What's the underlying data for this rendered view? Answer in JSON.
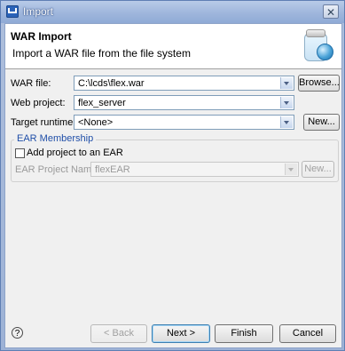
{
  "window": {
    "title": "Import"
  },
  "header": {
    "title": "WAR Import",
    "description": "Import a WAR file from the file system"
  },
  "form": {
    "war_file": {
      "label": "WAR file:",
      "value": "C:\\lcds\\flex.war",
      "browse_label": "Browse..."
    },
    "web_project": {
      "label": "Web project:",
      "value": "flex_server"
    },
    "target_runtime": {
      "label": "Target runtime:",
      "value": "<None>",
      "new_label": "New..."
    }
  },
  "ear_membership": {
    "title": "EAR Membership",
    "add_to_ear_label": "Add project to an EAR",
    "add_to_ear_checked": false,
    "ear_project_name_label": "EAR Project Name:",
    "ear_project_name_value": "flexEAR",
    "new_label": "New..."
  },
  "footer": {
    "help_icon": "?",
    "back_label": "< Back",
    "next_label": "Next >",
    "finish_label": "Finish",
    "cancel_label": "Cancel"
  },
  "icons": {
    "app": "eclipse-wtp-icon",
    "close": "close-icon",
    "wizard": "war-import-wizard-icon",
    "help": "help-icon"
  },
  "colors": {
    "group_title": "#1f4ea8",
    "disabled_text": "#9a9a9a"
  }
}
